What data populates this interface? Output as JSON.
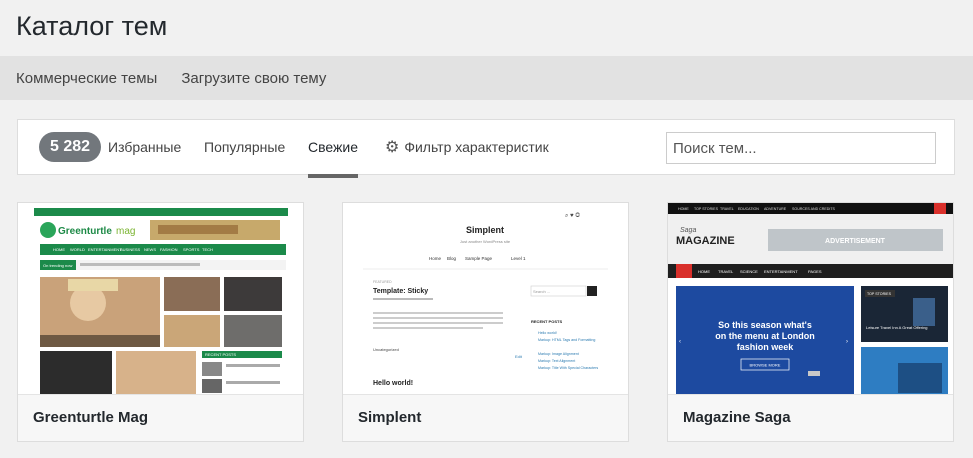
{
  "header": {
    "title": "Каталог тем"
  },
  "subnav": {
    "items": [
      "Коммерческие темы",
      "Загрузите свою тему"
    ]
  },
  "filter": {
    "count": "5 282",
    "tabs": [
      "Избранные",
      "Популярные",
      "Свежие"
    ],
    "active_tab": "Свежие",
    "feature_filter_label": "Фильтр характеристик",
    "search_placeholder": "Поиск тем..."
  },
  "themes": [
    {
      "name": "Greenturtle Mag",
      "preview": {
        "logo_a": "Greenturtle",
        "logo_b": "mag",
        "menu": [
          "HOME",
          "WORLD",
          "ENTERTAINMENT",
          "BUSINESS",
          "NEWS",
          "FASHION",
          "SPORTS",
          "TECH"
        ],
        "ticker": "On trending now",
        "widget": "RECENT POSTS"
      }
    },
    {
      "name": "Simplent",
      "preview": {
        "site_title": "Simplent",
        "tagline": "Just another WordPress site",
        "menu": [
          "Home",
          "Blog",
          "Sample Page",
          "Level 1"
        ],
        "featured": "FEATURED",
        "post_title": "Template: Sticky",
        "post2_title": "Hello world!",
        "search": "Search ...",
        "widget": "RECENT POSTS",
        "recent": [
          "Hello world!",
          "Markup: HTML Tags and Formatting",
          "Markup: Image Alignment",
          "Markup: Text Alignment",
          "Markup: Title With Special Characters"
        ],
        "category": "Uncategorized",
        "edit": "Edit"
      }
    },
    {
      "name": "Magazine Saga",
      "preview": {
        "top_menu": [
          "HOME",
          "TOP STORIES",
          "TRAVEL",
          "EDUCATION",
          "ADVENTURE",
          "SOURCES AND CREDITS"
        ],
        "logo_a": "Saga",
        "logo_b": "MAGAZINE",
        "ad": "ADVERTISEMENT",
        "menu": [
          "HOME",
          "TRAVEL",
          "SCIENCE",
          "ENTERTAINMENT",
          "PAGES"
        ],
        "headline": "So this season what's on the menu at London fashion week",
        "cta": "BROWSE MORE",
        "side_tag": "TOP STORIES",
        "side_caption": "Leisure Travel Inn A Great Offering"
      }
    }
  ]
}
